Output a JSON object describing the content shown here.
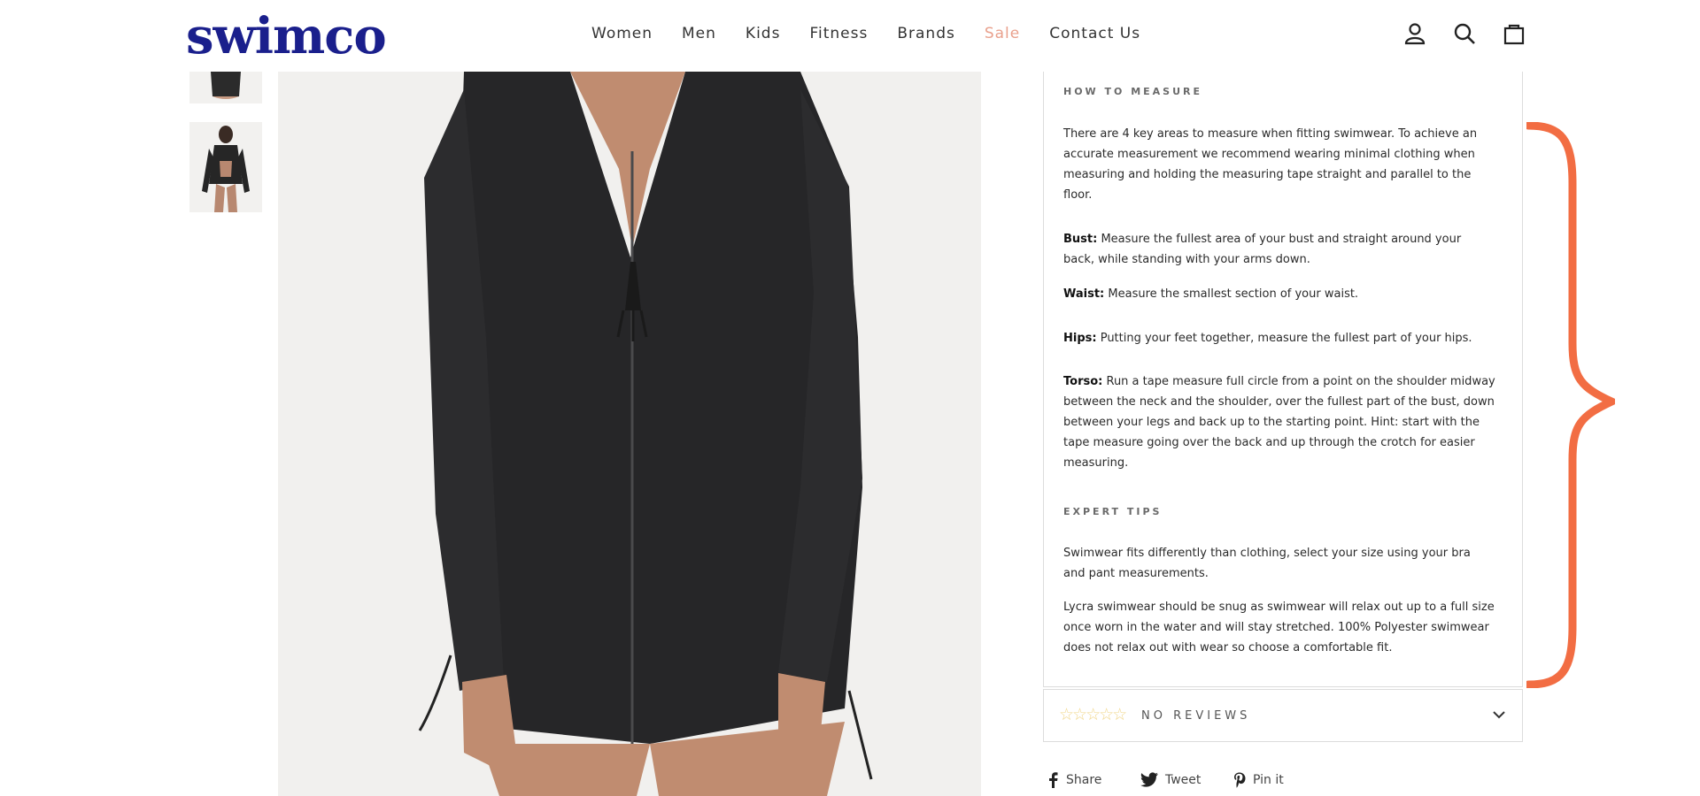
{
  "header": {
    "logo": "swimco",
    "nav": [
      {
        "label": "Women"
      },
      {
        "label": "Men"
      },
      {
        "label": "Kids"
      },
      {
        "label": "Fitness"
      },
      {
        "label": "Brands"
      },
      {
        "label": "Sale"
      },
      {
        "label": "Contact Us"
      }
    ],
    "icons": [
      "account-icon",
      "search-icon",
      "cart-icon"
    ]
  },
  "size_guide": {
    "how_to_measure_title": "HOW TO MEASURE",
    "intro": "There are 4 key areas to measure when fitting swimwear. To achieve an accurate measurement we recommend wearing minimal clothing when measuring and holding the measuring tape straight and parallel to the floor.",
    "measurements": [
      {
        "label": "Bust:",
        "text": " Measure the fullest area of your bust and straight around your back, while standing with your arms down."
      },
      {
        "label": "Waist:",
        "text": " Measure the smallest section of your waist."
      },
      {
        "label": "Hips:",
        "text": " Putting your feet together, measure the fullest part of your hips."
      },
      {
        "label": "Torso:",
        "text": " Run a tape measure full circle from a point on the shoulder midway between the neck and the shoulder, over the fullest part of the bust, down between your legs and back up to the starting point. Hint: start with the tape measure going over the back and up through the crotch for easier measuring."
      }
    ],
    "expert_tips_title": "EXPERT TIPS",
    "tips": [
      "Swimwear fits differently than clothing, select your size using your bra and pant measurements.",
      "Lycra swimwear should be snug as swimwear will relax out up to a full size once worn in the water and will stay stretched. 100% Polyester swimwear does not relax out with wear so choose a comfortable fit."
    ]
  },
  "reviews": {
    "stars": "☆☆☆☆☆",
    "label": "NO REVIEWS",
    "rating": 0
  },
  "share": {
    "share_label": "Share",
    "tweet_label": "Tweet",
    "pin_label": "Pin it"
  },
  "colors": {
    "brand": "#1a1f8c",
    "sale": "#e9a08c",
    "brace": "#f26d43",
    "star": "#f1d78a"
  }
}
